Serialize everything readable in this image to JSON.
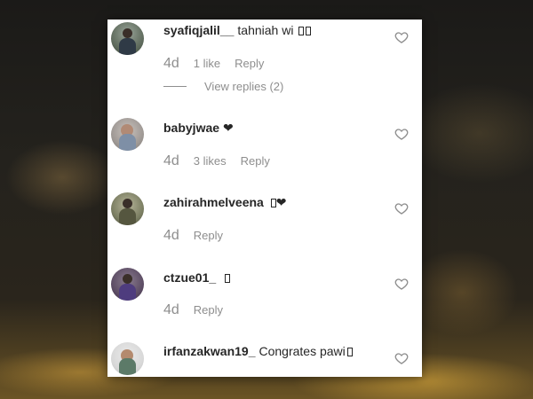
{
  "comments": [
    {
      "username": "syafiqjalil__",
      "text": "tahniah wi",
      "trailing_glyphs": 2,
      "time": "4d",
      "likes": "1 like",
      "reply_label": "Reply",
      "view_replies": "View replies (2)"
    },
    {
      "username": "babyjwae",
      "text": "❤",
      "trailing_glyphs": 0,
      "time": "4d",
      "likes": "3 likes",
      "reply_label": "Reply"
    },
    {
      "username": "zahirahmelveena",
      "text": "❤",
      "leading_glyph": true,
      "time": "4d",
      "reply_label": "Reply"
    },
    {
      "username": "ctzue01_",
      "text": "",
      "trailing_glyphs": 1,
      "time": "4d",
      "reply_label": "Reply"
    },
    {
      "username": "irfanzakwan19_",
      "text": "Congrates pawi",
      "trailing_glyphs": 1
    }
  ],
  "icons": {
    "like": "heart-outline-icon"
  },
  "colors": {
    "text": "#262626",
    "muted": "#8e8e8e",
    "panel": "#ffffff"
  }
}
